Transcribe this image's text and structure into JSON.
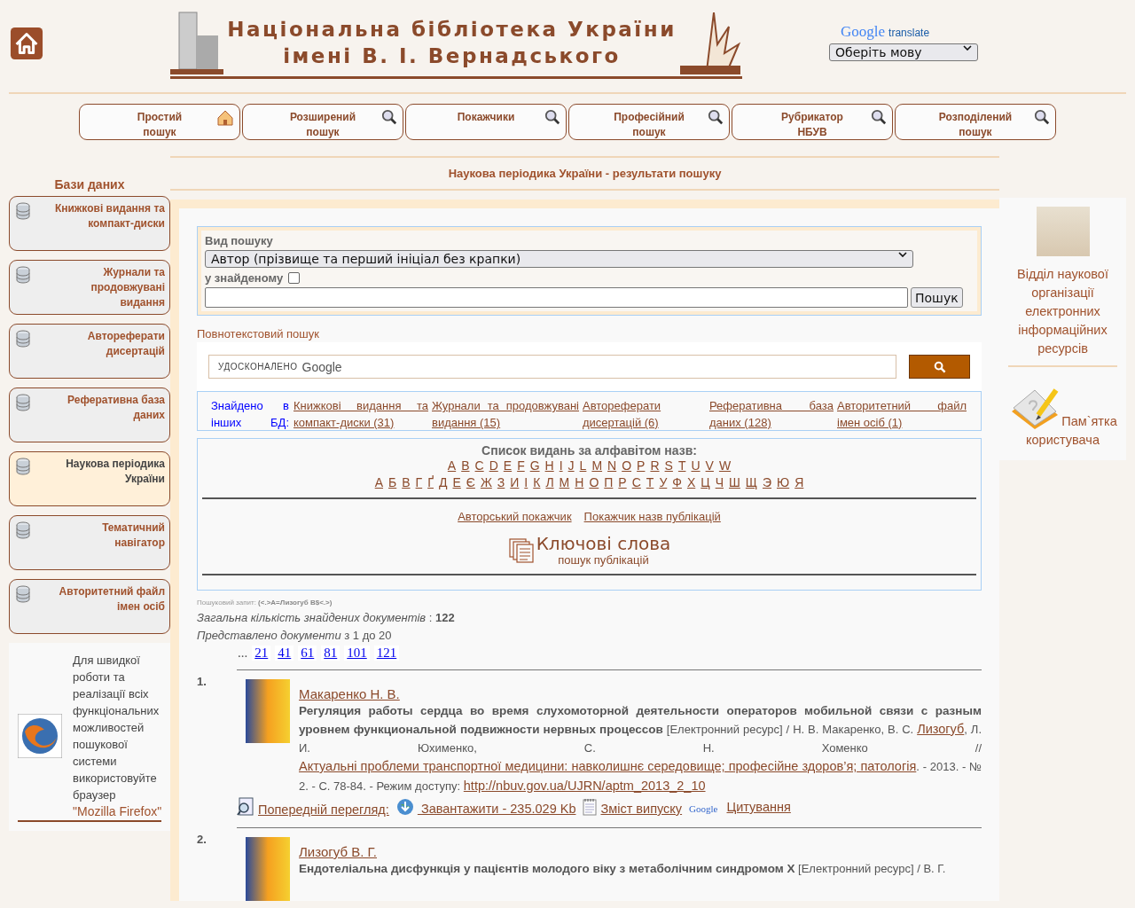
{
  "header": {
    "title_lines": [
      "Національна бібліотека України",
      "імені В. І. Вернадського"
    ],
    "translate_brand": "Google",
    "translate_label": "translate",
    "language_select": "Оберіть мову"
  },
  "nav": [
    {
      "label": "Простий пошук",
      "kind": "house"
    },
    {
      "label": "Розширений пошук",
      "kind": "search"
    },
    {
      "label": "Покажчики",
      "kind": "search"
    },
    {
      "label": "Професійний пошук",
      "kind": "search"
    },
    {
      "label": "Рубрикатор НБУВ",
      "kind": "search"
    },
    {
      "label": "Розподілений пошук",
      "kind": "search"
    }
  ],
  "page_title": "Наукова періодика України - результати пошуку",
  "sidebar": {
    "heading": "Бази даних",
    "items": [
      {
        "label": "Книжкові видання та компакт-диски",
        "selected": false
      },
      {
        "label": "Журнали та продовжувані видання",
        "selected": false
      },
      {
        "label": "Автореферати дисертацій",
        "selected": false
      },
      {
        "label": "Реферативна база даних",
        "selected": false
      },
      {
        "label": "Наукова періодика України",
        "selected": true
      },
      {
        "label": "Тематичний навігатор",
        "selected": false
      },
      {
        "label": "Авторитетний файл імен осіб",
        "selected": false
      }
    ],
    "browser_note": "Для швидкої роботи та реалізації всіх функціональних можливостей пошукової системи використовуйте браузер",
    "browser_link": "\"Mozilla Firefox\""
  },
  "search_form": {
    "type_label": "Вид пошуку",
    "type_value": "Автор (прізвище та перший ініціал без крапки)",
    "in_found_label": "у знайденому",
    "in_found_checked": false,
    "button": "Пошук"
  },
  "fulltext": {
    "label": "Повнотекстовий пошук",
    "placeholder_small": "УДОСКОНАЛЕНО",
    "placeholder_brand": "Google"
  },
  "other_dbs": {
    "label": "Знайдено в інших БД:",
    "links": [
      "Книжкові видання та компакт-диски (31)",
      "Журнали та продовжувані видання (15)",
      "Автореферати дисертацій (6)",
      "Реферативна база даних (128)",
      "Авторитетний файл імен осіб (1)"
    ]
  },
  "alphabet": {
    "heading": "Список видань за алфавітом назв:",
    "latin": [
      "A",
      "B",
      "C",
      "D",
      "E",
      "F",
      "G",
      "H",
      "I",
      "J",
      "L",
      "M",
      "N",
      "O",
      "P",
      "R",
      "S",
      "T",
      "U",
      "V",
      "W"
    ],
    "cyrillic": [
      "А",
      "Б",
      "В",
      "Г",
      "Ґ",
      "Д",
      "Е",
      "Є",
      "Ж",
      "З",
      "И",
      "І",
      "К",
      "Л",
      "М",
      "Н",
      "О",
      "П",
      "Р",
      "С",
      "Т",
      "У",
      "Ф",
      "Х",
      "Ц",
      "Ч",
      "Ш",
      "Щ",
      "Э",
      "Ю",
      "Я"
    ],
    "index_links": [
      "Авторський покажчик",
      "Покажчик назв публікацій"
    ],
    "keywords_title": "Ключові слова",
    "keywords_subtitle": "пошук публікацій"
  },
  "query": {
    "label": "Пошуковий запит:",
    "value": "(<.>A=Лизогуб В$<.>)"
  },
  "total": {
    "label": "Загальна кількість знайдених документів",
    "separator": ":",
    "value": "122"
  },
  "shown": {
    "label": "Представлено документи",
    "range": "з 1 до 20"
  },
  "pages": {
    "ellipsis": "...",
    "links": [
      "21",
      "41",
      "61",
      "81",
      "101",
      "121"
    ]
  },
  "results": [
    {
      "number": "1.",
      "author": "Макаренко Н. В.",
      "parts": [
        {
          "kind": "title",
          "text": "Регуляция работы сердца во время слухомоторной деятельности операторов мобильной связи с разным уровнем функциональной подвижности нервных процессов"
        },
        {
          "kind": "text",
          "text": " [Електронний ресурс] / Н. В. Макаренко, В. С. "
        },
        {
          "kind": "link",
          "text": "Лизогуб"
        },
        {
          "kind": "text",
          "text": ", Л. И. Юхименко, С. Н. Хоменко // "
        },
        {
          "kind": "link",
          "text": "Актуальні проблеми транспортної медицини: навколишнє середовище; професійне здоров’я; патологія"
        },
        {
          "kind": "text",
          "text": ". - 2013. - № 2. - С. 78-84. - Режим доступу: "
        },
        {
          "kind": "link",
          "text": "http://nbuv.gov.ua/UJRN/aptm_2013_2_10"
        }
      ],
      "actions": [
        {
          "kind": "preview",
          "label": "Попередній перегляд:"
        },
        {
          "kind": "download",
          "label": " Завантажити - 235.029 Kb"
        },
        {
          "kind": "contents",
          "label": "Зміст випуску"
        },
        {
          "kind": "scholar",
          "label": "Цитування",
          "icon_text": "Google"
        }
      ]
    },
    {
      "number": "2.",
      "author": "Лизогуб В. Г.",
      "parts": [
        {
          "kind": "title",
          "text": "Ендотеліальна дисфункція у пацієнтів молодого віку з метаболічним синдромом Х"
        },
        {
          "kind": "text",
          "text": " [Електронний ресурс] / В. Г."
        }
      ]
    }
  ],
  "right_panel": {
    "department": "Відділ наукової організації електронних інформаційних ресурсів",
    "guide": "Пам`ятка користувача"
  }
}
